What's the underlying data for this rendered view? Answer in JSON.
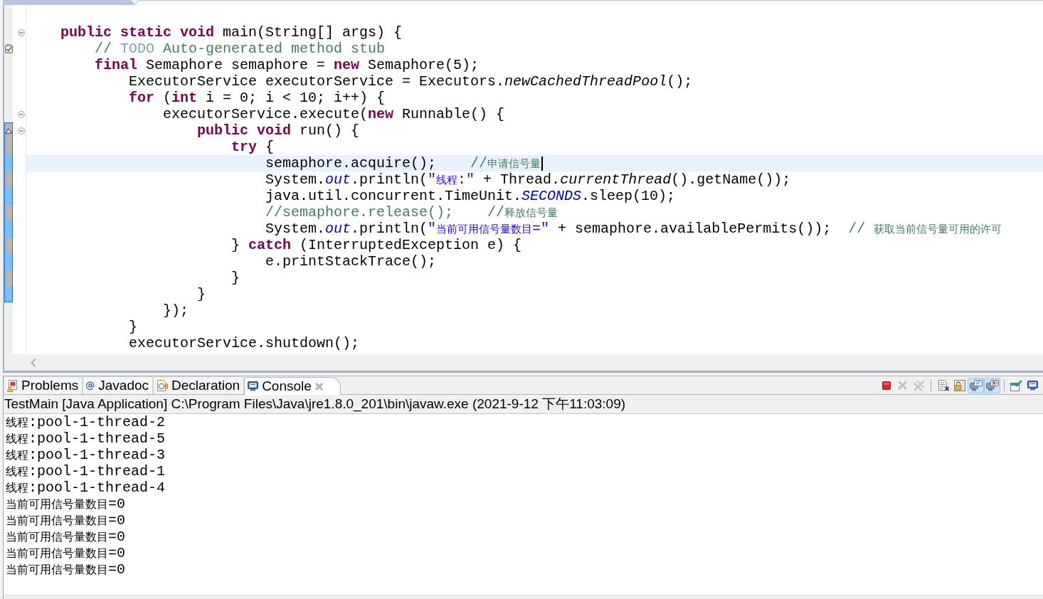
{
  "editor": {
    "lines": [
      {
        "tokens": [
          {
            "kind": "keyword",
            "text": "public static void"
          },
          {
            "kind": "plain",
            "text": " main(String[] args) {"
          }
        ],
        "collapsible": true,
        "in_range": false,
        "current": false,
        "children": [
          {
            "tokens": [
              {
                "kind": "comment",
                "text": "// "
              },
              {
                "kind": "task_tag",
                "text": "TODO"
              },
              {
                "kind": "comment",
                "text": " Auto-generated method stub"
              }
            ],
            "collapsible": false,
            "in_range": false,
            "current": false,
            "annotation": {
              "kind": "task"
            }
          },
          {
            "tokens": [
              {
                "kind": "keyword",
                "text": "final"
              },
              {
                "kind": "plain",
                "text": " Semaphore semaphore = "
              },
              {
                "kind": "keyword",
                "text": "new"
              },
              {
                "kind": "plain",
                "text": " Semaphore(5);"
              }
            ],
            "collapsible": false,
            "in_range": false,
            "current": false,
            "children": [
              {
                "tokens": [
                  {
                    "kind": "plain",
                    "text": "ExecutorService executorService = Executors."
                  },
                  {
                    "kind": "static_method",
                    "text": "newCachedThreadPool"
                  },
                  {
                    "kind": "plain",
                    "text": "();"
                  }
                ],
                "collapsible": false,
                "in_range": false,
                "current": false
              },
              {
                "tokens": [
                  {
                    "kind": "keyword",
                    "text": "for"
                  },
                  {
                    "kind": "plain",
                    "text": " ("
                  },
                  {
                    "kind": "keyword",
                    "text": "int"
                  },
                  {
                    "kind": "plain",
                    "text": " i = 0; i < 10; i++) {"
                  }
                ],
                "collapsible": false,
                "in_range": false,
                "current": false,
                "children": [
                  {
                    "tokens": [
                      {
                        "kind": "plain",
                        "text": "executorService.execute("
                      },
                      {
                        "kind": "keyword",
                        "text": "new"
                      },
                      {
                        "kind": "plain",
                        "text": " Runnable() {"
                      }
                    ],
                    "collapsible": true,
                    "in_range": false,
                    "current": false,
                    "children": [
                      {
                        "tokens": [
                          {
                            "kind": "keyword",
                            "text": "public void"
                          },
                          {
                            "kind": "plain",
                            "text": " run() {"
                          }
                        ],
                        "collapsible": true,
                        "in_range": true,
                        "current": false,
                        "annotation": {
                          "kind": "override"
                        },
                        "children": [
                          {
                            "tokens": [
                              {
                                "kind": "keyword",
                                "text": "try"
                              },
                              {
                                "kind": "plain",
                                "text": " {"
                              }
                            ],
                            "collapsible": false,
                            "in_range": true,
                            "current": false,
                            "children": [
                              {
                                "tokens": [
                                  {
                                    "kind": "plain",
                                    "text": "semaphore.acquire();    "
                                  },
                                  {
                                    "kind": "comment",
                                    "text": "//申请信号量"
                                  }
                                ],
                                "collapsible": false,
                                "in_range": true,
                                "current": true
                              },
                              {
                                "tokens": [
                                  {
                                    "kind": "plain",
                                    "text": "System."
                                  },
                                  {
                                    "kind": "static_field",
                                    "text": "out"
                                  },
                                  {
                                    "kind": "plain",
                                    "text": ".println("
                                  },
                                  {
                                    "kind": "string",
                                    "text": "\"线程:\""
                                  },
                                  {
                                    "kind": "plain",
                                    "text": " + Thread."
                                  },
                                  {
                                    "kind": "static_method",
                                    "text": "currentThread"
                                  },
                                  {
                                    "kind": "plain",
                                    "text": "().getName());"
                                  }
                                ],
                                "collapsible": false,
                                "in_range": true,
                                "current": false
                              },
                              {
                                "tokens": [
                                  {
                                    "kind": "plain",
                                    "text": "java.util.concurrent.TimeUnit."
                                  },
                                  {
                                    "kind": "static_field",
                                    "text": "SECONDS"
                                  },
                                  {
                                    "kind": "plain",
                                    "text": ".sleep(10);"
                                  }
                                ],
                                "collapsible": false,
                                "in_range": true,
                                "current": false
                              },
                              {
                                "tokens": [
                                  {
                                    "kind": "comment",
                                    "text": "//semaphore.release();    //释放信号量"
                                  }
                                ],
                                "collapsible": false,
                                "in_range": true,
                                "current": false
                              },
                              {
                                "tokens": [
                                  {
                                    "kind": "plain",
                                    "text": "System."
                                  },
                                  {
                                    "kind": "static_field",
                                    "text": "out"
                                  },
                                  {
                                    "kind": "plain",
                                    "text": ".println("
                                  },
                                  {
                                    "kind": "string",
                                    "text": "\"当前可用信号量数目=\""
                                  },
                                  {
                                    "kind": "plain",
                                    "text": " + semaphore.availablePermits());  "
                                  },
                                  {
                                    "kind": "comment",
                                    "text": "// 获取当前信号量可用的许可"
                                  }
                                ],
                                "collapsible": false,
                                "in_range": true,
                                "current": false
                              }
                            ]
                          },
                          {
                            "tokens": [
                              {
                                "kind": "plain",
                                "text": "} "
                              },
                              {
                                "kind": "keyword",
                                "text": "catch"
                              },
                              {
                                "kind": "plain",
                                "text": " (InterruptedException e) {"
                              }
                            ],
                            "collapsible": false,
                            "in_range": true,
                            "current": false,
                            "children": [
                              {
                                "tokens": [
                                  {
                                    "kind": "plain",
                                    "text": "e.printStackTrace();"
                                  }
                                ],
                                "collapsible": false,
                                "in_range": true,
                                "current": false
                              }
                            ]
                          },
                          {
                            "tokens": [
                              {
                                "kind": "plain",
                                "text": "}"
                              }
                            ],
                            "collapsible": false,
                            "in_range": true,
                            "current": false
                          }
                        ]
                      },
                      {
                        "tokens": [
                          {
                            "kind": "plain",
                            "text": "}"
                          }
                        ],
                        "collapsible": false,
                        "in_range": true,
                        "current": false
                      }
                    ]
                  },
                  {
                    "tokens": [
                      {
                        "kind": "plain",
                        "text": "});"
                      }
                    ],
                    "collapsible": false,
                    "in_range": false,
                    "current": false
                  }
                ]
              },
              {
                "tokens": [
                  {
                    "kind": "plain",
                    "text": "}"
                  }
                ],
                "collapsible": false,
                "in_range": false,
                "current": false
              },
              {
                "tokens": [
                  {
                    "kind": "plain",
                    "text": "executorService.shutdown();"
                  }
                ],
                "collapsible": false,
                "in_range": false,
                "current": false
              }
            ]
          }
        ]
      }
    ]
  },
  "bottom_panel": {
    "tabs": [
      {
        "kind": "problems",
        "label": "Problems",
        "selected": false
      },
      {
        "kind": "javadoc",
        "label": "Javadoc",
        "selected": false
      },
      {
        "kind": "declaration",
        "label": "Declaration",
        "selected": false
      },
      {
        "kind": "console",
        "label": "Console",
        "selected": true
      }
    ],
    "toolbar_groups": [
      {
        "buttons": [
          {
            "kind": "stop",
            "disabled": false,
            "pressed": false
          },
          {
            "kind": "remove",
            "disabled": true,
            "pressed": false
          },
          {
            "kind": "remove_all",
            "disabled": true,
            "pressed": false
          }
        ]
      },
      {
        "buttons": [
          {
            "kind": "clear",
            "disabled": false,
            "pressed": false
          },
          {
            "kind": "scroll_lock",
            "disabled": false,
            "pressed": false
          },
          {
            "kind": "show_stdout",
            "disabled": false,
            "pressed": true
          },
          {
            "kind": "show_stderr",
            "disabled": false,
            "pressed": true
          }
        ]
      },
      {
        "buttons": [
          {
            "kind": "pin",
            "disabled": false,
            "pressed": false
          },
          {
            "kind": "display",
            "disabled": false,
            "pressed": false
          }
        ]
      }
    ],
    "console": {
      "header": "TestMain [Java Application] C:\\Program Files\\Java\\jre1.8.0_201\\bin\\javaw.exe (2021-9-12 下午11:03:09)",
      "lines": [
        "线程:pool-1-thread-2",
        "线程:pool-1-thread-5",
        "线程:pool-1-thread-3",
        "线程:pool-1-thread-1",
        "线程:pool-1-thread-4",
        "当前可用信号量数目=0",
        "当前可用信号量数目=0",
        "当前可用信号量数目=0",
        "当前可用信号量数目=0",
        "当前可用信号量数目=0"
      ]
    }
  }
}
